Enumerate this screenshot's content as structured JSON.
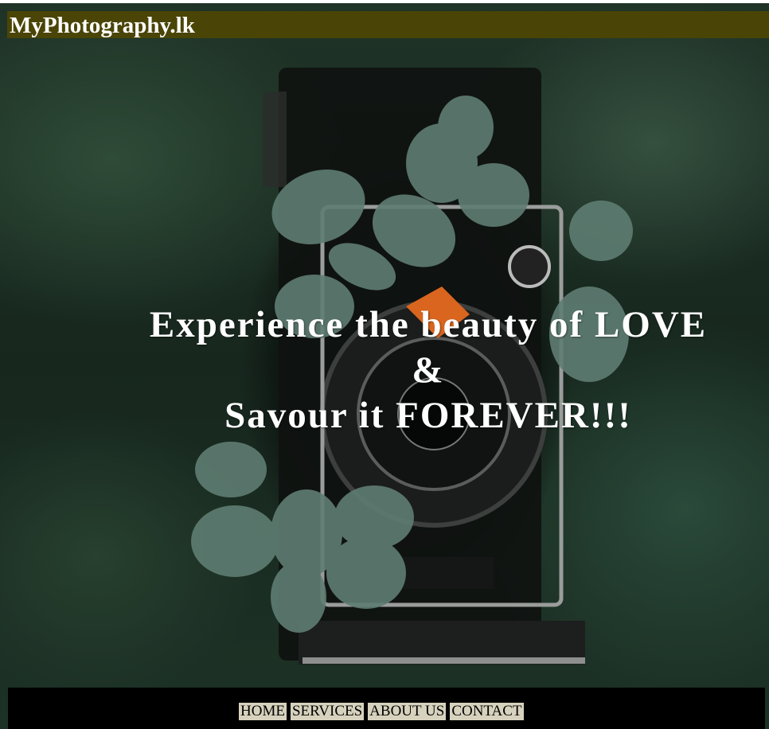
{
  "header": {
    "site_title": "MyPhotography.lk"
  },
  "hero": {
    "line1": "Experience the beauty of LOVE",
    "line2": "&",
    "line3": "Savour it FOREVER!!!",
    "image": "camera-with-leaves-photo"
  },
  "nav": {
    "items": [
      {
        "label": "HOME"
      },
      {
        "label": "SERVICES"
      },
      {
        "label": "ABOUT US"
      },
      {
        "label": "CONTACT"
      }
    ]
  },
  "colors": {
    "header_bg": "#4a4506",
    "footer_bg": "#000000",
    "nav_item_bg": "#d7d2bd",
    "text_light": "#ffffff"
  }
}
